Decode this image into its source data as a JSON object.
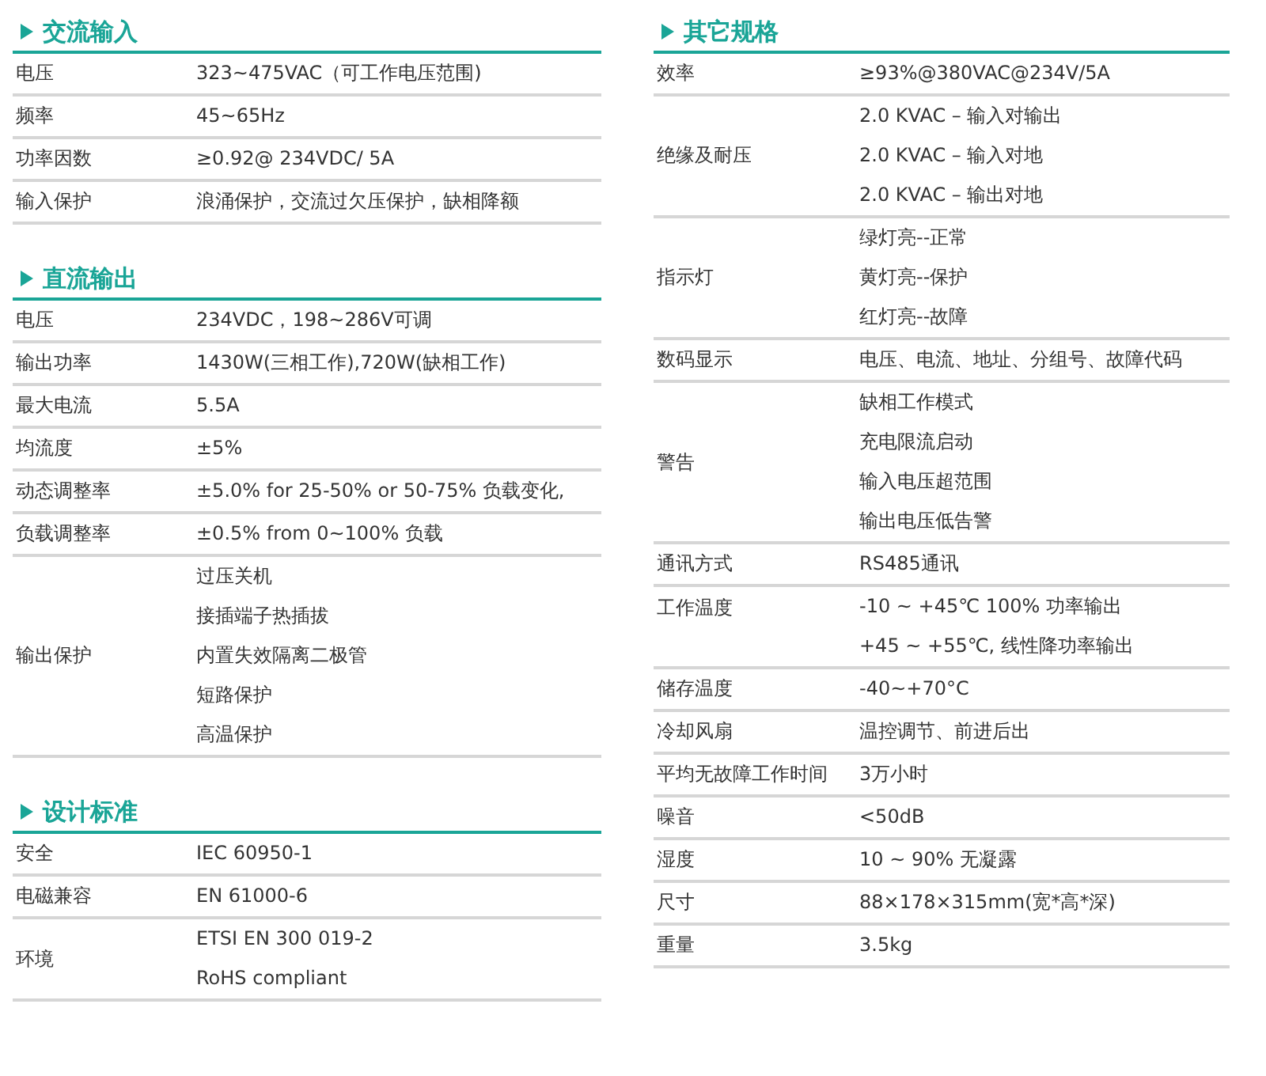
{
  "columns": [
    {
      "sections": [
        {
          "title": "交流输入",
          "rows": [
            {
              "label": "电压",
              "values": [
                "323~475VAC（可工作电压范围)"
              ]
            },
            {
              "label": "频率",
              "values": [
                "45~65Hz"
              ]
            },
            {
              "label": "功率因数",
              "values": [
                "≥0.92@ 234VDC/ 5A"
              ]
            },
            {
              "label": "输入保护",
              "values": [
                "浪涌保护，交流过欠压保护，缺相降额"
              ]
            }
          ]
        },
        {
          "title": "直流输出",
          "rows": [
            {
              "label": "电压",
              "values": [
                "234VDC，198~286V可调"
              ]
            },
            {
              "label": "输出功率",
              "values": [
                "1430W(三相工作),720W(缺相工作)"
              ]
            },
            {
              "label": "最大电流",
              "values": [
                "5.5A"
              ]
            },
            {
              "label": "均流度",
              "values": [
                "±5%"
              ]
            },
            {
              "label": "动态调整率",
              "values": [
                "±5.0% for 25-50% or 50-75% 负载变化,"
              ]
            },
            {
              "label": "负载调整率",
              "values": [
                "±0.5% from 0~100% 负载"
              ]
            },
            {
              "label": "输出保护",
              "values": [
                "过压关机",
                "接插端子热插拔",
                "内置失效隔离二极管",
                "短路保护",
                "高温保护"
              ]
            }
          ]
        },
        {
          "title": "设计标准",
          "rows": [
            {
              "label": "安全",
              "values": [
                "IEC 60950-1"
              ]
            },
            {
              "label": "电磁兼容",
              "values": [
                "EN 61000-6"
              ]
            },
            {
              "label": "环境",
              "values": [
                "ETSI EN 300 019-2",
                "RoHS compliant"
              ]
            }
          ]
        }
      ]
    },
    {
      "sections": [
        {
          "title": "其它规格",
          "rows": [
            {
              "label": "效率",
              "values": [
                "≥93%@380VAC@234V/5A"
              ]
            },
            {
              "label": "绝缘及耐压",
              "values": [
                "2.0 KVAC – 输入对输出",
                "2.0 KVAC – 输入对地",
                "2.0 KVAC – 输出对地"
              ]
            },
            {
              "label": "指示灯",
              "values": [
                "绿灯亮--正常",
                "黄灯亮--保护",
                "红灯亮--故障"
              ]
            },
            {
              "label": "数码显示",
              "values": [
                "电压、电流、地址、分组号、故障代码"
              ]
            },
            {
              "label": "警告",
              "values": [
                "缺相工作模式",
                "充电限流启动",
                "输入电压超范围",
                "输出电压低告警"
              ]
            },
            {
              "label": "通讯方式",
              "values": [
                "RS485通讯"
              ]
            },
            {
              "label": "工作温度",
              "values": [
                "-10 ~ +45℃ 100% 功率输出",
                "+45 ~ +55℃, 线性降功率输出"
              ],
              "label_top": true
            },
            {
              "label": "储存温度",
              "values": [
                "-40~+70°C"
              ]
            },
            {
              "label": "冷却风扇",
              "values": [
                "温控调节、前进后出"
              ]
            },
            {
              "label": "平均无故障工作时间",
              "values": [
                "3万小时"
              ]
            },
            {
              "label": "噪音",
              "values": [
                "<50dB"
              ]
            },
            {
              "label": "湿度",
              "values": [
                "10 ~ 90% 无凝露"
              ]
            },
            {
              "label": "尺寸",
              "values": [
                "88×178×315mm(宽*高*深)"
              ]
            },
            {
              "label": "重量",
              "values": [
                "3.5kg"
              ]
            }
          ]
        }
      ]
    }
  ]
}
